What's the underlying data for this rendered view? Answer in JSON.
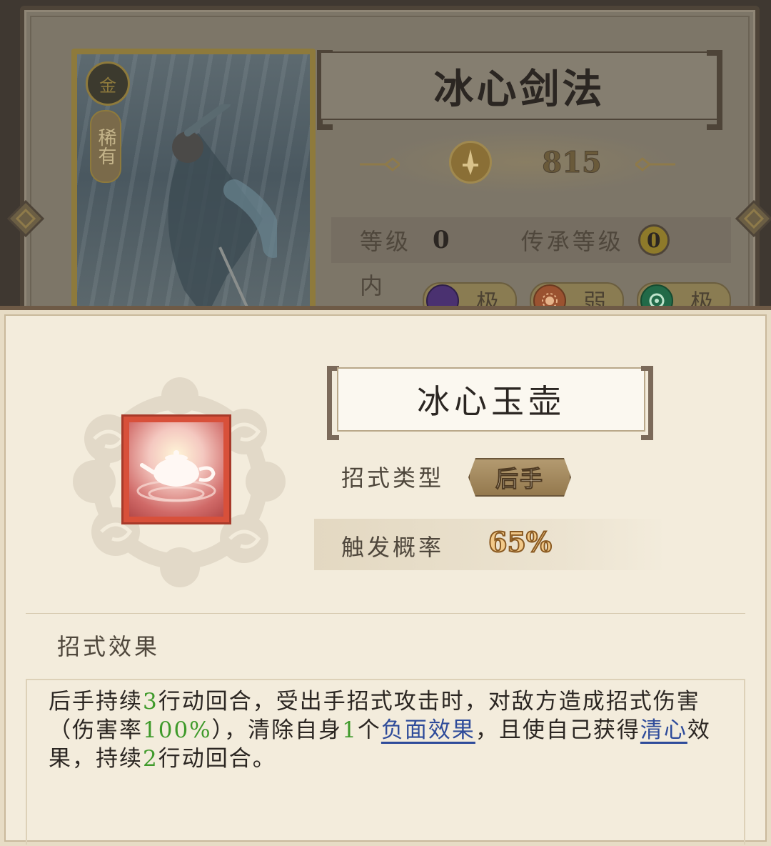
{
  "background_card": {
    "skill_name": "冰心剑法",
    "power": "815",
    "rarity_label": "稀有",
    "rank_glyph": "金",
    "level_label": "等级",
    "level_value": "0",
    "inheritance_label": "传承等级",
    "inheritance_value": "0",
    "neixi_label": "内息",
    "neixi": [
      {
        "icon": "moon-orb-icon",
        "color": "#5a3a8a",
        "grade": "极"
      },
      {
        "icon": "sun-orb-icon",
        "color": "#b8663a",
        "grade": "弱"
      },
      {
        "icon": "crescent-orb-icon",
        "color": "#2e8a5a",
        "grade": "极"
      }
    ]
  },
  "detail": {
    "move_name": "冰心玉壶",
    "type_label": "招式类型",
    "type_value": "后手",
    "rate_label": "触发概率",
    "rate_value": "65%",
    "effect_title": "招式效果",
    "effect_segments": [
      {
        "t": "后手持续",
        "style": "text"
      },
      {
        "t": "3",
        "style": "num"
      },
      {
        "t": "行动回合，受出手招式攻击时，对敌方造成招式伤害（伤害率",
        "style": "text"
      },
      {
        "t": "100%",
        "style": "num"
      },
      {
        "t": "），清除自身",
        "style": "text"
      },
      {
        "t": "1",
        "style": "num"
      },
      {
        "t": "个",
        "style": "text"
      },
      {
        "t": "负面效果",
        "style": "link"
      },
      {
        "t": "，且使自己获得",
        "style": "text"
      },
      {
        "t": "清心",
        "style": "link"
      },
      {
        "t": "效果，持续",
        "style": "text"
      },
      {
        "t": "2",
        "style": "num"
      },
      {
        "t": "行动回合。",
        "style": "text"
      }
    ]
  },
  "colors": {
    "panel_bg": "#f3ecdc",
    "number_green": "#3e9a2a",
    "link_blue": "#2e4b9a",
    "rate_gold": "#f2c989"
  }
}
